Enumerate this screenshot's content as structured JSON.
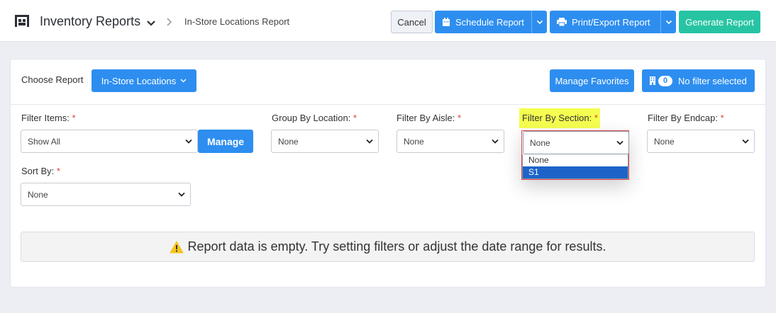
{
  "header": {
    "app_title": "Inventory Reports",
    "breadcrumb": "In-Store Locations Report",
    "buttons": {
      "cancel": "Cancel",
      "schedule": "Schedule Report",
      "print_export": "Print/Export Report",
      "generate": "Generate Report"
    }
  },
  "report_picker": {
    "label": "Choose Report",
    "selected": "In-Store Locations",
    "manage_favorites": "Manage Favorites",
    "filter_count": "0",
    "filter_status": "No filter selected"
  },
  "filters": {
    "filter_items": {
      "label": "Filter Items:",
      "required": "*",
      "value": "Show All",
      "manage": "Manage"
    },
    "group_by_location": {
      "label": "Group By Location:",
      "required": "*",
      "value": "None"
    },
    "filter_by_aisle": {
      "label": "Filter By Aisle:",
      "required": "*",
      "value": "None"
    },
    "filter_by_section": {
      "label": "Filter By Section:",
      "required": "*",
      "value": "None",
      "options": [
        "None",
        "S1"
      ],
      "highlighted_option": "S1"
    },
    "filter_by_endcap": {
      "label": "Filter By Endcap:",
      "required": "*",
      "value": "None"
    },
    "sort_by": {
      "label": "Sort By:",
      "required": "*",
      "value": "None"
    }
  },
  "empty_message": "Report data is empty. Try setting filters or adjust the date range for results.",
  "colors": {
    "primary": "#2d8ef0",
    "success": "#27c4a3",
    "required": "#e23d3d",
    "highlight": "#f5ff50",
    "selected_option": "#1e64c8"
  },
  "icons": {
    "logo": "warehouse-icon",
    "schedule": "calendar-icon",
    "print": "printer-icon",
    "filter": "building-icon",
    "warning": "warning-icon"
  }
}
